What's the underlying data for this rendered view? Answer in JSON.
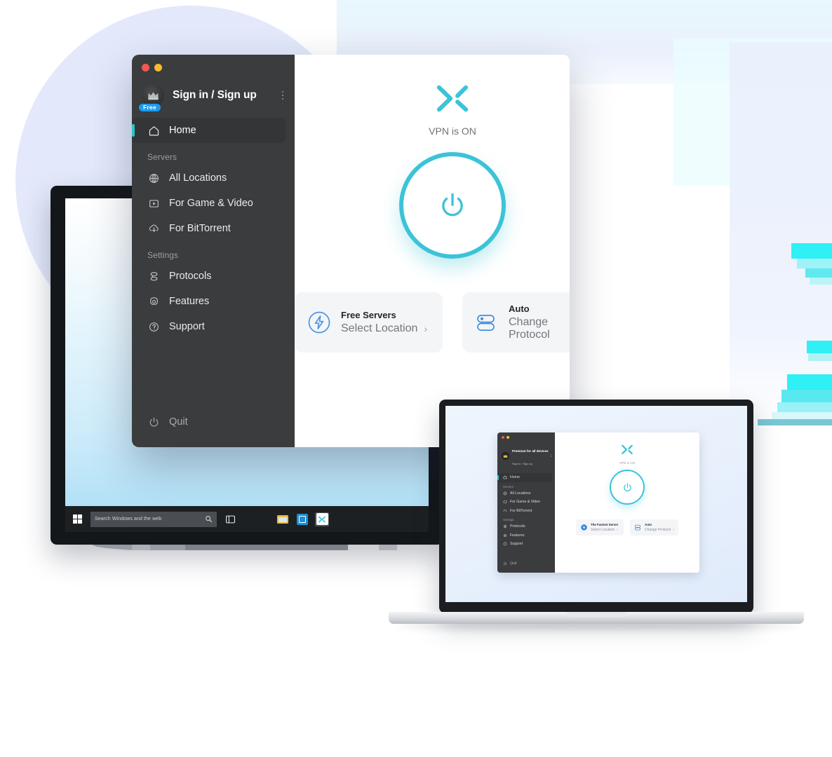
{
  "background": {
    "accent_cyan": "#2bc4c9",
    "accent_blue": "#3f8fe0",
    "circle_color": "#e3e9fb",
    "stripe_color": "#2ff0f5"
  },
  "app_window": {
    "traffic_lights": [
      "close",
      "minimize"
    ],
    "account": {
      "name": "Sign in / Sign up",
      "badge": "Free",
      "avatar_icon": "crown-icon",
      "menu_icon": "kebab-menu-icon"
    },
    "nav": {
      "home": {
        "label": "Home",
        "icon": "home-icon"
      },
      "groups": [
        {
          "title": "Servers",
          "items": [
            {
              "label": "All Locations",
              "icon": "globe-icon"
            },
            {
              "label": "For Game & Video",
              "icon": "video-play-icon"
            },
            {
              "label": "For BitTorrent",
              "icon": "download-cloud-icon"
            }
          ]
        },
        {
          "title": "Settings",
          "items": [
            {
              "label": "Protocols",
              "icon": "protocols-icon"
            },
            {
              "label": "Features",
              "icon": "gear-icon"
            },
            {
              "label": "Support",
              "icon": "question-circle-icon"
            }
          ]
        }
      ],
      "quit": {
        "label": "Quit",
        "icon": "power-icon"
      }
    },
    "main": {
      "logo": "x-vpn-logo",
      "status": "VPN is ON",
      "power_button_icon": "power-icon",
      "cards": [
        {
          "title": "Free Servers",
          "subtitle": "Select Location",
          "icon": "lightning-bolt-circle-icon",
          "chevron": "›"
        },
        {
          "title": "Auto",
          "subtitle": "Change Protocol",
          "icon": "toggle-switches-icon",
          "chevron": "›"
        }
      ]
    }
  },
  "monitor": {
    "taskbar": {
      "start_icon": "windows-start-icon",
      "search_placeholder": "Search Windows and the web",
      "search_icon": "search-icon",
      "task_view_icon": "task-view-icon",
      "apps": [
        {
          "name": "file-explorer-icon",
          "active": false
        },
        {
          "name": "microsoft-store-icon",
          "active": false
        },
        {
          "name": "x-vpn-taskbar-icon",
          "active": true
        }
      ]
    }
  },
  "laptop": {
    "app": {
      "account": {
        "title": "Premium for all devices",
        "subtitle": "Sign in / Sign up",
        "avatar_icon": "crown-icon",
        "menu_icon": "kebab-menu-icon"
      },
      "nav": {
        "home": {
          "label": "Home",
          "icon": "home-icon"
        },
        "groups": [
          {
            "title": "Servers",
            "items": [
              {
                "label": "All Locations",
                "icon": "globe-icon"
              },
              {
                "label": "For Game & Video",
                "icon": "video-play-icon"
              },
              {
                "label": "For BitTorrent",
                "icon": "download-cloud-icon"
              }
            ]
          },
          {
            "title": "Settings",
            "items": [
              {
                "label": "Protocols",
                "icon": "protocols-icon"
              },
              {
                "label": "Features",
                "icon": "gear-icon"
              },
              {
                "label": "Support",
                "icon": "question-circle-icon"
              }
            ]
          }
        ],
        "quit": {
          "label": "Quit",
          "icon": "power-icon"
        }
      },
      "main": {
        "logo": "x-vpn-logo",
        "status": "VPN is ON",
        "power_button_icon": "power-icon",
        "cards": [
          {
            "title": "The Fastest Server",
            "subtitle": "Select Location",
            "icon": "lightning-bolt-filled-icon",
            "chevron": "›"
          },
          {
            "title": "Auto",
            "subtitle": "Change Protocol",
            "icon": "toggle-switches-icon",
            "chevron": "›"
          }
        ]
      }
    }
  }
}
